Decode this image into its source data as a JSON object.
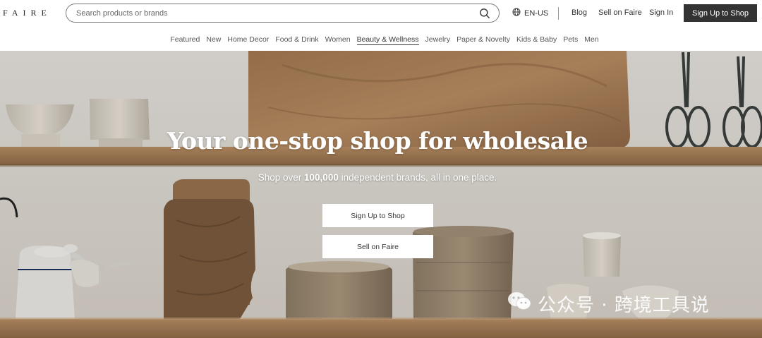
{
  "header": {
    "logo": "FAIRE",
    "search_placeholder": "Search products or brands",
    "language": "EN-US",
    "links": [
      "Blog",
      "Sell on Faire",
      "Sign In"
    ],
    "signup_label": "Sign Up to Shop"
  },
  "categories": {
    "items": [
      "Featured",
      "New",
      "Home Decor",
      "Food & Drink",
      "Women",
      "Beauty & Wellness",
      "Jewelry",
      "Paper & Novelty",
      "Kids & Baby",
      "Pets",
      "Men"
    ],
    "active": "Beauty & Wellness"
  },
  "hero": {
    "title": "Your one-stop shop for wholesale",
    "subtitle_prefix": "Shop over ",
    "subtitle_bold": "100,000",
    "subtitle_suffix": " independent brands, all in one place.",
    "primary_button": "Sign Up to Shop",
    "secondary_button": "Sell on Faire"
  },
  "watermark": {
    "text": "公众号 · 跨境工具说"
  },
  "colors": {
    "primary_dark": "#333333",
    "white": "#ffffff",
    "shelf_wood": "#a67c52"
  }
}
